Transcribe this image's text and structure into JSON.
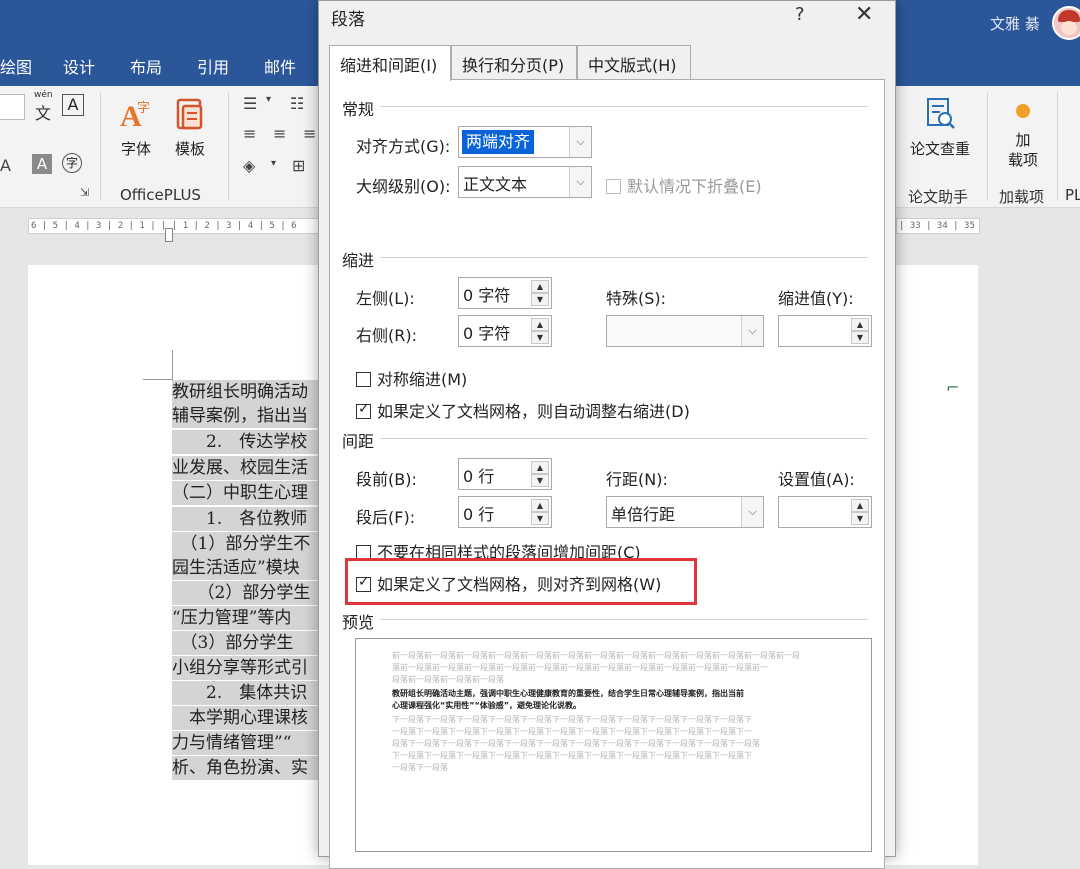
{
  "app": {
    "user_name": "文雅 綦"
  },
  "ribbon_tabs": [
    "绘图",
    "设计",
    "布局",
    "引用",
    "邮件"
  ],
  "ribbon": {
    "font_btn": "字体",
    "template_btn": "模板",
    "officeplus_group": "OfficePLUS",
    "paper_check_btn": "论文查重",
    "paper_assistant_group": "论文助手",
    "addins_btn": "加\n载项",
    "addins_btn_line1": "加",
    "addins_btn_line2": "载项",
    "addins_group": "加载项",
    "cut_group": "PL",
    "wen_label": "wén",
    "wen_char": "文",
    "a_box": "A",
    "a_small": "A",
    "zi_ring": "字"
  },
  "ruler": {
    "left_text": "6 | 5 | 4 | 3 | 2 | 1 |  |  | 1 | 2 | 3 | 4 | 5 | 6",
    "right_text": "| 33 | 34 | 35 | 36"
  },
  "document": {
    "lines": [
      "教研组长明确活动",
      "辅导案例，指出当",
      "　　2.　传达学校",
      "业发展、校园生活",
      "（二）中职生心理",
      "　　1.　各位教师",
      "　（1）部分学生不",
      "园生活适应”模块",
      "　　（2）部分学生",
      "“压力管理”等内",
      "　（3）部分学生",
      "小组分享等形式引",
      "　　2.　集体共识",
      "　本学期心理课核",
      "力与情绪管理”“",
      "析、角色扮演、实"
    ]
  },
  "dialog": {
    "title": "段落",
    "help": "?",
    "close": "✕",
    "tabs": [
      "缩进和间距(I)",
      "换行和分页(P)",
      "中文版式(H)"
    ],
    "general": {
      "section": "常规",
      "alignment_label": "对齐方式(G):",
      "alignment_value": "两端对齐",
      "outline_label": "大纲级别(O):",
      "outline_value": "正文文本",
      "collapse_label": "默认情况下折叠(E)"
    },
    "indent": {
      "section": "缩进",
      "left_label": "左侧(L):",
      "left_value": "0 字符",
      "right_label": "右侧(R):",
      "right_value": "0 字符",
      "special_label": "特殊(S):",
      "special_value": "",
      "by_label": "缩进值(Y):",
      "by_value": "",
      "mirror_label": "对称缩进(M)",
      "auto_right_label": "如果定义了文档网格，则自动调整右缩进(D)"
    },
    "spacing": {
      "section": "间距",
      "before_label": "段前(B):",
      "before_value": "0 行",
      "after_label": "段后(F):",
      "after_value": "0 行",
      "line_label": "行距(N):",
      "line_value": "单倍行距",
      "at_label": "设置值(A):",
      "at_value": "",
      "no_space_label": "不要在相同样式的段落间增加间距(C)",
      "snap_grid_label": "如果定义了文档网格，则对齐到网格(W)"
    },
    "preview": {
      "section": "预览",
      "prev_lines": [
        "前一段落前一段落前一段落前一段落前一段落前一段落前一段落前一段落前一段落前一段落前一段落前一段落前一段",
        "落前一段落前一段落前一段落前一段落前一段落前一段落前一段落前一段落前一段落前一段落前一段落前一",
        "段落前一段落前一段落前一段落"
      ],
      "cur_lines": [
        "教研组长明确活动主题，强调中职生心理健康教育的重要性，结合学生日常心理辅导案例，指出当前",
        "心理课程强化“实用性”“体验感”，避免理论化说教。"
      ],
      "next_lines": [
        "下一段落下一段落下一段落下一段落下一段落下一段落下一段落下一段落下一段落下一段落下一段落下",
        "一段落下一段落下一段落下一段落下一段落下一段落下一段落下一段落下一段落下一段落下一段落下一",
        "段落下一段落下一段落下一段落下一段落下一段落下一段落下一段落下一段落下一段落下一段落下一段落",
        "下一段落下一段落下一段落下一段落下一段落下一段落下一段落下一段落下一段落下一段落下一段落下",
        "一段落下一段落"
      ]
    }
  },
  "colors": {
    "ribbon_blue": "#2b579a",
    "highlight_red": "#e0363b",
    "selection_blue": "#0a64d8"
  }
}
